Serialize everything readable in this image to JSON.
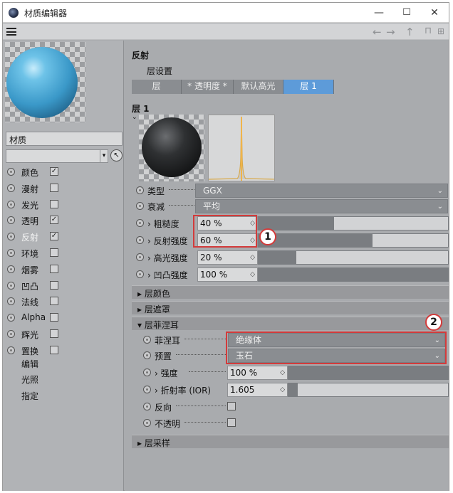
{
  "window": {
    "title": "材质编辑器",
    "controls": [
      "—",
      "☐",
      "✕"
    ]
  },
  "toolbar": {
    "icons": [
      "back-arrow-icon",
      "forward-arrow-icon",
      "up-arrow-icon",
      "lock-icon",
      "new-window-icon"
    ]
  },
  "left": {
    "material_name": "材质",
    "channels": [
      {
        "label": "颜色",
        "checked": true
      },
      {
        "label": "漫射",
        "checked": false
      },
      {
        "label": "发光",
        "checked": false
      },
      {
        "label": "透明",
        "checked": true
      },
      {
        "label": "反射",
        "checked": true,
        "active": true
      },
      {
        "label": "环境",
        "checked": false
      },
      {
        "label": "烟雾",
        "checked": false
      },
      {
        "label": "凹凸",
        "checked": false
      },
      {
        "label": "法线",
        "checked": false
      },
      {
        "label": "Alpha",
        "checked": false
      },
      {
        "label": "辉光",
        "checked": false
      },
      {
        "label": "置换",
        "checked": false
      }
    ],
    "extra": [
      "编辑",
      "光照",
      "指定"
    ]
  },
  "right": {
    "section": "反射",
    "layer_settings": "层设置",
    "tabs": [
      "层",
      "* 透明度 *",
      "默认高光",
      "层 1"
    ],
    "layer_title": "层 1",
    "type_label": "类型",
    "type_value": "GGX",
    "falloff_label": "衰减",
    "falloff_value": "平均",
    "roughness_label": "› 粗糙度",
    "roughness_value": "40 %",
    "refl_strength_label": "› 反射强度",
    "refl_strength_value": "60 %",
    "spec_strength_label": "› 高光强度",
    "spec_strength_value": "20 %",
    "bump_strength_label": "› 凹凸强度",
    "bump_strength_value": "100 %",
    "group_color": "层颜色",
    "group_mask": "层遮罩",
    "group_fresnel": "层菲涅耳",
    "fresnel_label": "菲涅耳",
    "fresnel_value": "绝缘体",
    "preset_label": "预置",
    "preset_value": "玉石",
    "strength_label": "› 强度",
    "strength_value": "100 %",
    "ior_label": "› 折射率 (IOR)",
    "ior_value": "1.605",
    "invert_label": "反向",
    "opaque_label": "不透明",
    "group_sampling": "层采样",
    "sliders": {
      "roughness": 0.4,
      "refl_strength": 0.6,
      "spec_strength": 0.2,
      "bump_strength": 1.0,
      "strength": 1.0,
      "ior": 0.06
    }
  },
  "annotations": {
    "badge1": "1",
    "badge2": "2"
  },
  "colors": {
    "accent_tab": "#5d9bd9",
    "highlight": "#d33b3b"
  }
}
